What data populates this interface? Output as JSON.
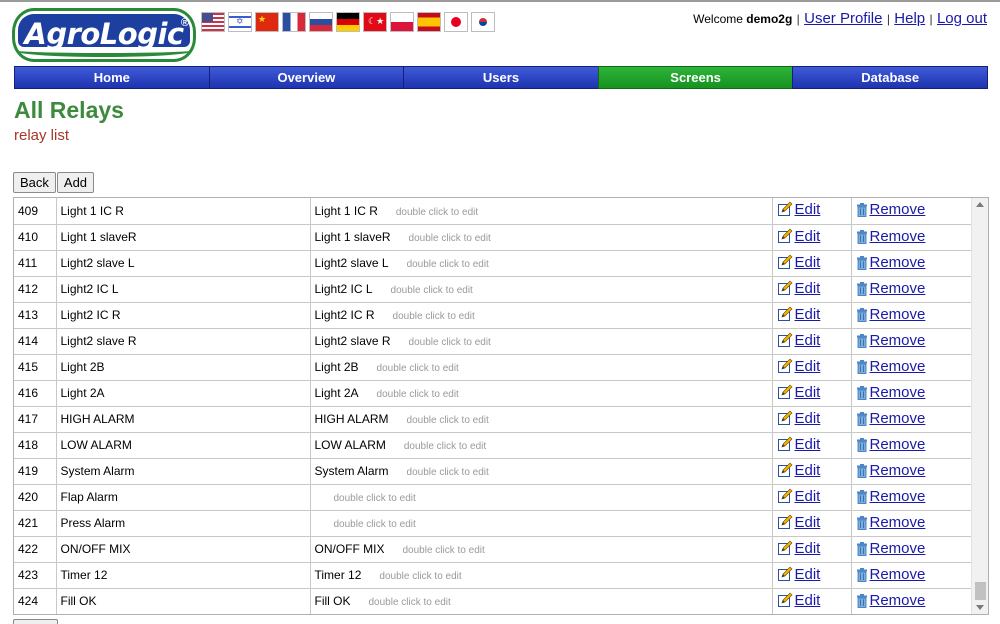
{
  "brand": {
    "logo_text": "AgroLogic",
    "logo_mark": "®"
  },
  "languages": [
    "us-flag",
    "il-flag",
    "cn-flag",
    "fr-flag",
    "ru-flag",
    "de-flag",
    "tr-flag",
    "pl-flag",
    "es-flag",
    "jp-flag",
    "kr-flag"
  ],
  "user": {
    "welcome": "Welcome",
    "username": "demo2g",
    "sep": "|",
    "profile_label": "User Profile",
    "help_label": "Help",
    "logout_label": "Log out"
  },
  "nav": {
    "items": [
      {
        "label": "Home"
      },
      {
        "label": "Overview"
      },
      {
        "label": "Users"
      },
      {
        "label": "Screens"
      },
      {
        "label": "Database"
      }
    ],
    "active": "Screens"
  },
  "page": {
    "title": "All Relays",
    "subtitle": "relay list"
  },
  "toolbar": {
    "back_label": "Back",
    "add_label": "Add"
  },
  "table": {
    "hint": "double click to edit",
    "edit_label": "Edit",
    "remove_label": "Remove",
    "rows": [
      {
        "id": "409",
        "name": "Light 1 IC R",
        "label": "Light 1 IC R"
      },
      {
        "id": "410",
        "name": "Light 1 slaveR",
        "label": "Light 1 slaveR"
      },
      {
        "id": "411",
        "name": "Light2 slave L",
        "label": "Light2 slave L"
      },
      {
        "id": "412",
        "name": "Light2 IC L",
        "label": "Light2 IC L"
      },
      {
        "id": "413",
        "name": "Light2 IC R",
        "label": "Light2 IC R"
      },
      {
        "id": "414",
        "name": "Light2 slave R",
        "label": "Light2 slave R"
      },
      {
        "id": "415",
        "name": "Light 2B",
        "label": "Light 2B"
      },
      {
        "id": "416",
        "name": "Light 2A",
        "label": "Light 2A"
      },
      {
        "id": "417",
        "name": "HIGH ALARM",
        "label": "HIGH ALARM"
      },
      {
        "id": "418",
        "name": "LOW ALARM",
        "label": "LOW ALARM"
      },
      {
        "id": "419",
        "name": "System Alarm",
        "label": "System Alarm"
      },
      {
        "id": "420",
        "name": "Flap Alarm",
        "label": ""
      },
      {
        "id": "421",
        "name": "Press Alarm",
        "label": ""
      },
      {
        "id": "422",
        "name": "ON/OFF MIX",
        "label": "ON/OFF MIX"
      },
      {
        "id": "423",
        "name": "Timer 12",
        "label": "Timer 12"
      },
      {
        "id": "424",
        "name": "Fill OK",
        "label": "Fill OK"
      }
    ]
  },
  "colors": {
    "nav_blue": "#2a45c8",
    "nav_active_green": "#1fa02a",
    "title_green": "#3d8a3d",
    "subtitle_red": "#a8352a",
    "link_blue": "#1a1aa8"
  }
}
